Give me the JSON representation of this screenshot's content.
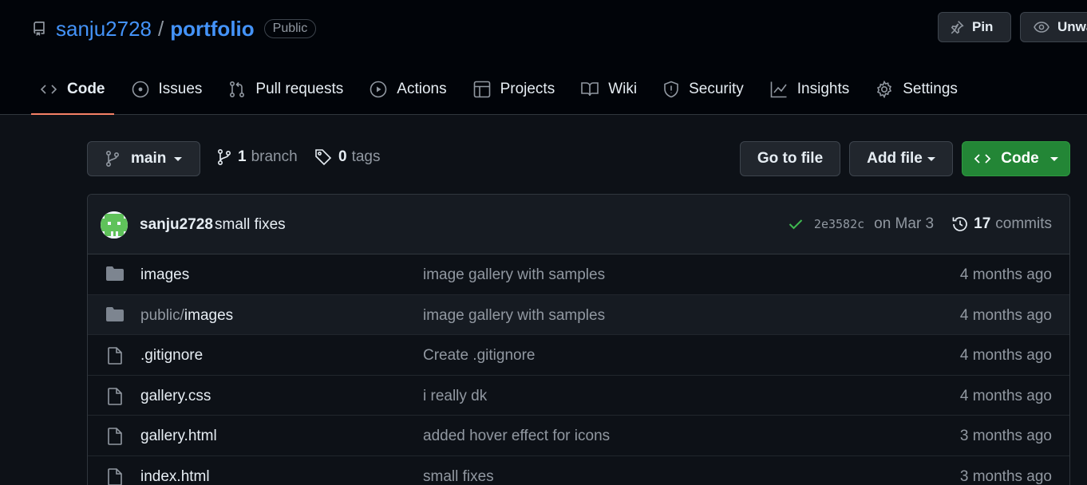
{
  "repo": {
    "owner": "sanju2728",
    "slash": "/",
    "name": "portfolio",
    "visibility": "Public"
  },
  "header_buttons": {
    "pin": "Pin",
    "unwatch": "Unwa"
  },
  "tabs": [
    {
      "label": "Code",
      "icon": "code-icon",
      "active": true
    },
    {
      "label": "Issues",
      "icon": "issue-icon"
    },
    {
      "label": "Pull requests",
      "icon": "pull-request-icon"
    },
    {
      "label": "Actions",
      "icon": "play-icon"
    },
    {
      "label": "Projects",
      "icon": "table-icon"
    },
    {
      "label": "Wiki",
      "icon": "book-icon"
    },
    {
      "label": "Security",
      "icon": "shield-icon"
    },
    {
      "label": "Insights",
      "icon": "graph-icon"
    },
    {
      "label": "Settings",
      "icon": "gear-icon"
    }
  ],
  "toolbar": {
    "branch": "main",
    "branch_count": "1",
    "branch_label": "branch",
    "tag_count": "0",
    "tag_label": "tags",
    "go_to_file": "Go to file",
    "add_file": "Add file",
    "code": "Code"
  },
  "latest_commit": {
    "author": "sanju2728",
    "message": "small fixes",
    "sha": "2e3582c",
    "date": "on Mar 3",
    "commit_count": "17",
    "commits_label": "commits"
  },
  "files": [
    {
      "type": "folder",
      "prefix": "",
      "name": "images",
      "message": "image gallery with samples",
      "age": "4 months ago"
    },
    {
      "type": "folder",
      "prefix": "public/",
      "name": "images",
      "message": "image gallery with samples",
      "age": "4 months ago"
    },
    {
      "type": "file",
      "prefix": "",
      "name": ".gitignore",
      "message": "Create .gitignore",
      "age": "4 months ago"
    },
    {
      "type": "file",
      "prefix": "",
      "name": "gallery.css",
      "message": "i really dk",
      "age": "4 months ago"
    },
    {
      "type": "file",
      "prefix": "",
      "name": "gallery.html",
      "message": "added hover effect for icons",
      "age": "3 months ago"
    },
    {
      "type": "file",
      "prefix": "",
      "name": "index.html",
      "message": "small fixes",
      "age": "3 months ago"
    }
  ],
  "colors": {
    "accent_link": "#4493f8",
    "tab_underline": "#f78166",
    "primary_button": "#238636",
    "success_check": "#3fb950"
  }
}
